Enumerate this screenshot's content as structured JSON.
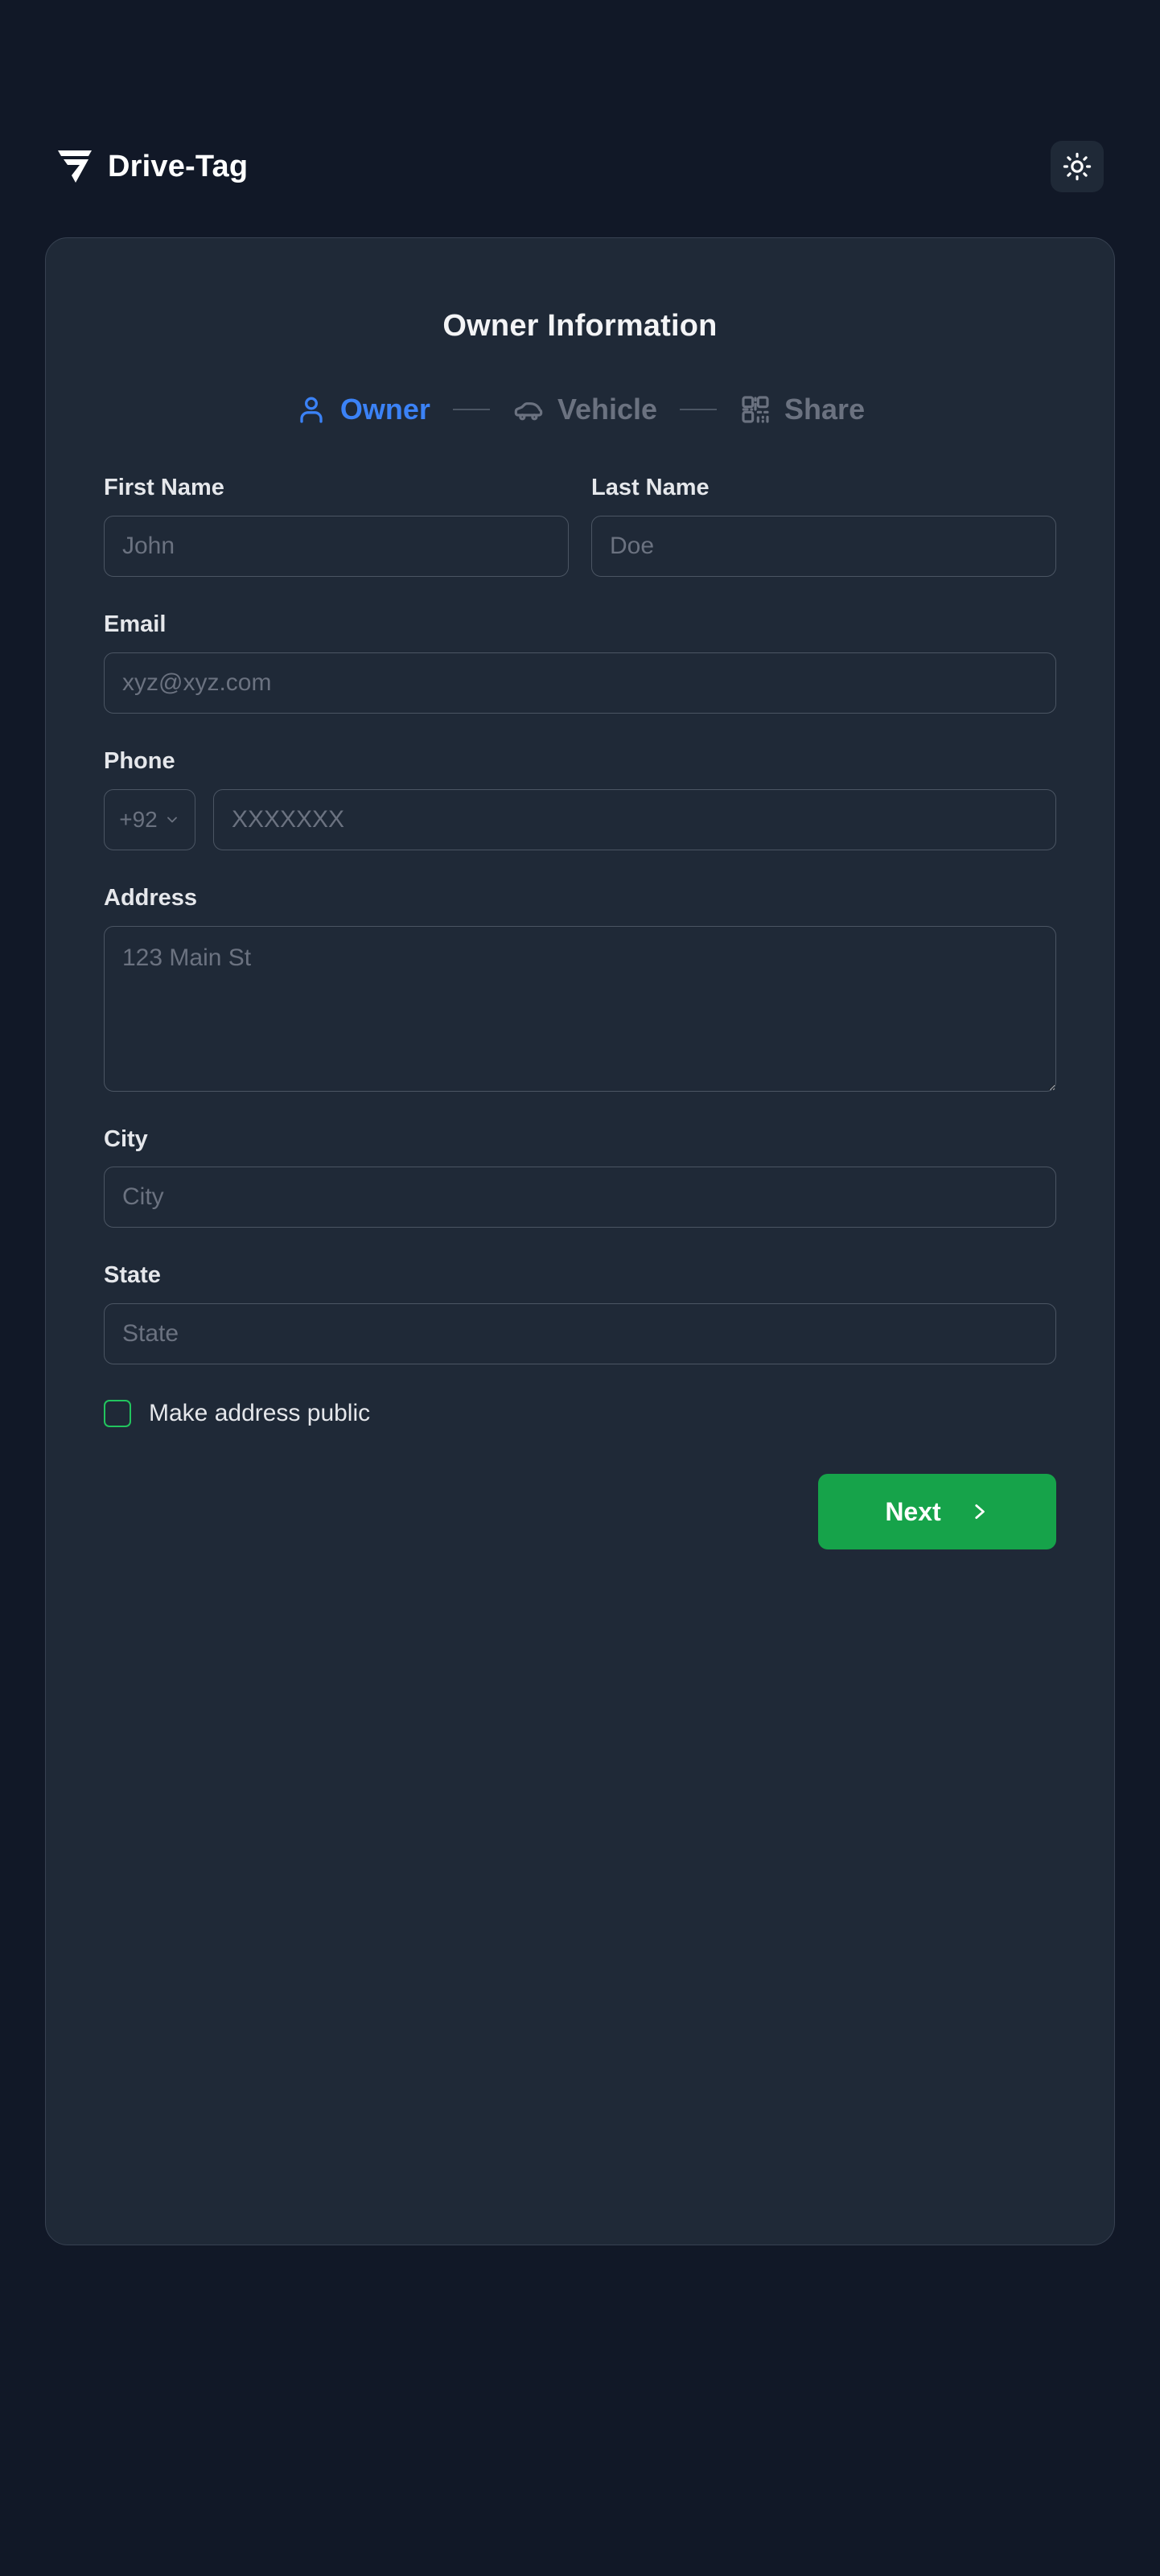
{
  "header": {
    "brand_name": "Drive-Tag",
    "logo_icon": "drive-tag-logo-icon",
    "theme_toggle_icon": "sun-icon"
  },
  "card": {
    "title": "Owner Information"
  },
  "stepper": {
    "separator": "—",
    "steps": [
      {
        "label": "Owner",
        "icon": "user-icon",
        "state": "active"
      },
      {
        "label": "Vehicle",
        "icon": "car-icon",
        "state": "inactive"
      },
      {
        "label": "Share",
        "icon": "qr-code-icon",
        "state": "inactive"
      }
    ]
  },
  "form": {
    "first_name": {
      "label": "First Name",
      "value": "",
      "placeholder": "John"
    },
    "last_name": {
      "label": "Last Name",
      "value": "",
      "placeholder": "Doe"
    },
    "email": {
      "label": "Email",
      "value": "",
      "placeholder": "xyz@xyz.com"
    },
    "phone": {
      "label": "Phone",
      "country_code": "+92",
      "value": "",
      "placeholder": "XXXXXXX"
    },
    "address": {
      "label": "Address",
      "value": "",
      "placeholder": "123 Main St"
    },
    "city": {
      "label": "City",
      "value": "",
      "placeholder": "City"
    },
    "state": {
      "label": "State",
      "value": "",
      "placeholder": "State"
    },
    "make_address_public": {
      "label": "Make address public",
      "checked": false
    }
  },
  "actions": {
    "next_label": "Next",
    "next_icon": "chevron-right-icon"
  },
  "colors": {
    "page_background": "#111827",
    "card_background": "#1f2937",
    "card_border": "#374151",
    "input_border": "#4b5563",
    "accent_blue": "#3b82f6",
    "accent_green": "#16a34a",
    "checkbox_green": "#22c55e",
    "text_primary": "#f3f4f6",
    "text_muted": "#6b7280"
  }
}
